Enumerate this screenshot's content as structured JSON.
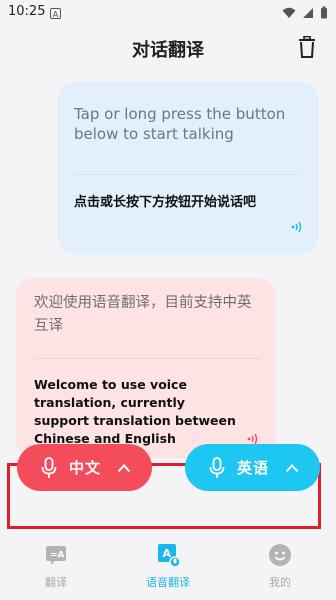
{
  "status": {
    "time": "10:25",
    "notif_icon": "A"
  },
  "header": {
    "title": "对话翻译",
    "trash_icon": "trash-icon"
  },
  "messages": [
    {
      "side": "right",
      "color": "#e2f0fb",
      "source_text": "Tap or long press the button below to start talking",
      "translated_text": "点击或长按下方按钮开始说话吧"
    },
    {
      "side": "left",
      "color": "#fde3e3",
      "source_text": "欢迎使用语音翻译，目前支持中英互译",
      "translated_text": "Welcome to use voice translation, currently support translation between Chinese and English"
    }
  ],
  "mic_buttons": {
    "chinese": {
      "label": "中文",
      "color": "#f34d5c"
    },
    "english": {
      "label": "英语",
      "color": "#1ec6f2"
    }
  },
  "nav": {
    "tabs": [
      {
        "label": "翻译",
        "icon": "translate-icon",
        "active": false
      },
      {
        "label": "语音翻译",
        "icon": "voice-translate-icon",
        "active": true
      },
      {
        "label": "我的",
        "icon": "profile-icon",
        "active": false
      }
    ]
  },
  "colors": {
    "accent": "#1cb6e8",
    "highlight_border": "#e01f2b"
  }
}
